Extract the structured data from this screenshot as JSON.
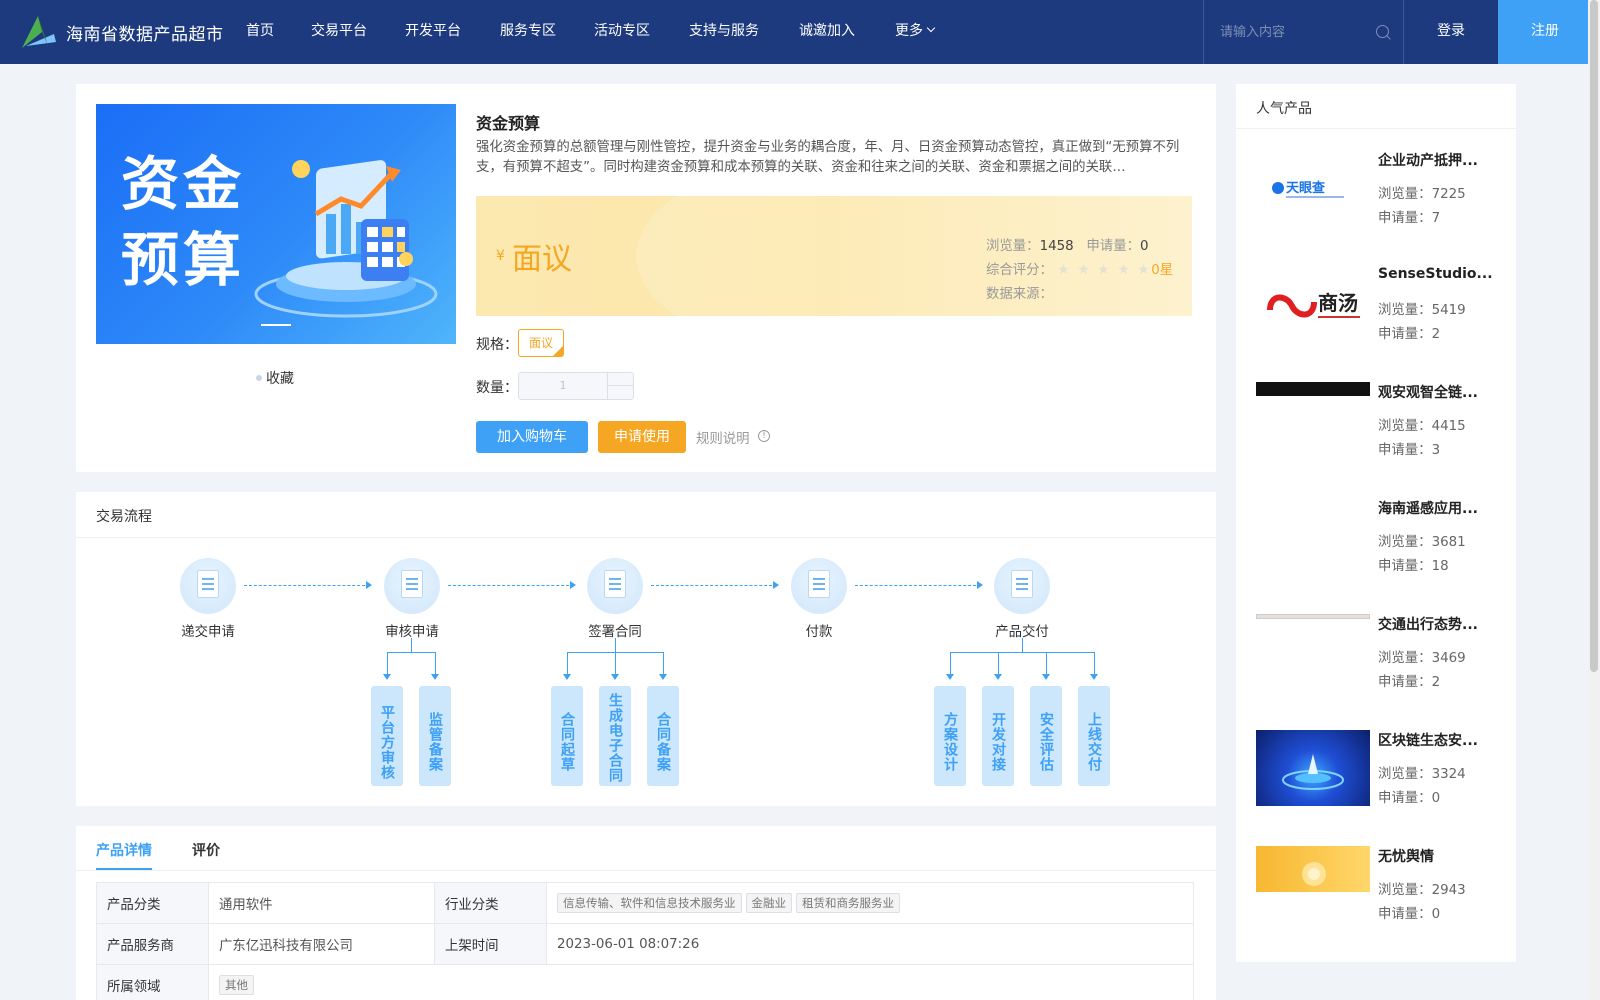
{
  "header": {
    "site_title": "海南省数据产品超市",
    "nav": [
      "首页",
      "交易平台",
      "开发平台",
      "服务专区",
      "活动专区",
      "支持与服务",
      "诚邀加入",
      "更多"
    ],
    "search_placeholder": "请输入内容",
    "login": "登录",
    "register": "注册"
  },
  "product": {
    "banner_text_line1": "资金",
    "banner_text_line2": "预算",
    "favorite": "收藏",
    "title": "资金预算",
    "description": "强化资金预算的总额管理与刚性管控，提升资金与业务的耦合度，年、月、日资金预算动态管控，真正做到“无预算不列支，有预算不超支”。同时构建资金预算和成本预算的关联、资金和往来之间的关联、资金和票据之间的关联…",
    "price_symbol": "¥",
    "price": "面议",
    "views_label": "浏览量：",
    "views": "1458",
    "applies_label": "申请量：",
    "applies": "0",
    "rating_label": "综合评分：",
    "rating_stars": 0,
    "rating_text": "0星",
    "source_label": "数据来源：",
    "spec_label": "规格：",
    "spec_value": "面议",
    "qty_label": "数量：",
    "qty_value": "1",
    "add_cart": "加入购物车",
    "apply": "申请使用",
    "rules": "规则说明"
  },
  "flow": {
    "title": "交易流程",
    "steps": [
      "递交申请",
      "审核申请",
      "签署合同",
      "付款",
      "产品交付"
    ],
    "sub_review": [
      "平台方审核",
      "监管备案"
    ],
    "sub_contract": [
      "合同起草",
      "生成电子合同",
      "合同备案"
    ],
    "sub_delivery": [
      "方案设计",
      "开发对接",
      "安全评估",
      "上线交付"
    ]
  },
  "detail": {
    "tabs": [
      "产品详情",
      "评价"
    ],
    "rows": {
      "category_label": "产品分类",
      "category": "通用软件",
      "industry_label": "行业分类",
      "industry_tags": [
        "信息传输、软件和信息技术服务业",
        "金融业",
        "租赁和商务服务业"
      ],
      "provider_label": "产品服务商",
      "provider": "广东亿迅科技有限公司",
      "listed_label": "上架时间",
      "listed": "2023-06-01 08:07:26",
      "domain_label": "所属领域",
      "domain_tags": [
        "其他"
      ]
    }
  },
  "sidebar": {
    "title": "人气产品",
    "views_label": "浏览量：",
    "applies_label": "申请量：",
    "items": [
      {
        "name": "企业动产抵押...",
        "views": "7225",
        "applies": "7",
        "thumb_text": "天眼查"
      },
      {
        "name": "SenseStudio...",
        "views": "5419",
        "applies": "2",
        "thumb_text": "商汤"
      },
      {
        "name": "观安观智全链...",
        "views": "4415",
        "applies": "3",
        "thumb_text": ""
      },
      {
        "name": "海南遥感应用...",
        "views": "3681",
        "applies": "18",
        "thumb_text": ""
      },
      {
        "name": "交通出行态势...",
        "views": "3469",
        "applies": "2",
        "thumb_text": ""
      },
      {
        "name": "区块链生态安...",
        "views": "3324",
        "applies": "0",
        "thumb_text": ""
      },
      {
        "name": "无忧舆情",
        "views": "2943",
        "applies": "0",
        "thumb_text": ""
      }
    ]
  },
  "colors": {
    "header_bg": "#1d3a7e",
    "accent_blue": "#3ea1f6",
    "accent_orange": "#f5a623"
  }
}
